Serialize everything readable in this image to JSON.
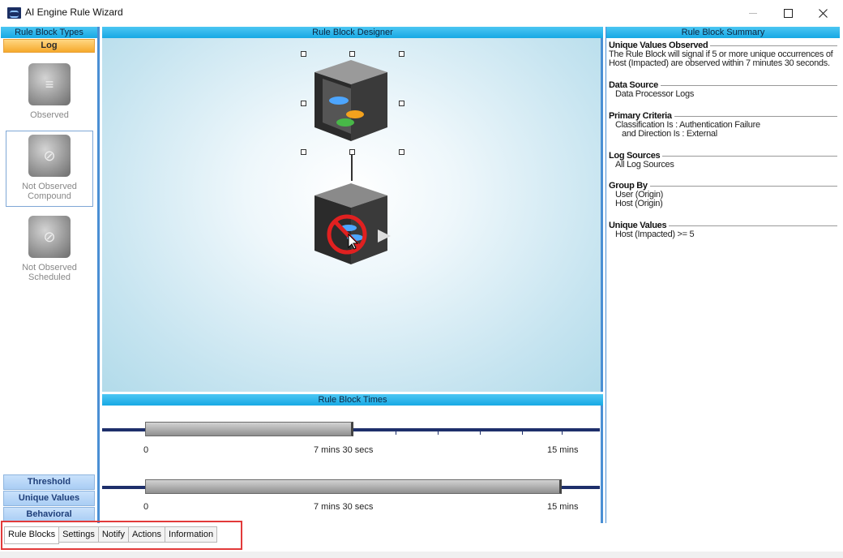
{
  "window": {
    "title": "AI Engine Rule Wizard"
  },
  "left_panel": {
    "header": "Rule Block Types",
    "active_category": "Log",
    "items": [
      {
        "label": "Observed",
        "icon": "observed-cube-icon"
      },
      {
        "label": "Not Observed Compound",
        "icon": "not-observed-cube-icon"
      },
      {
        "label": "Not Observed Scheduled",
        "icon": "not-observed-scheduled-cube-icon"
      }
    ],
    "categories": [
      "Threshold",
      "Unique Values",
      "Behavioral"
    ]
  },
  "designer": {
    "header": "Rule Block Designer"
  },
  "times": {
    "header": "Rule Block Times",
    "rows": [
      {
        "start": "0",
        "mid": "7 mins 30 secs",
        "end": "15 mins",
        "fill": 0.5
      },
      {
        "start": "0",
        "mid": "7 mins 30 secs",
        "end": "15 mins",
        "fill": 1.0
      }
    ]
  },
  "summary": {
    "header": "Rule Block Summary",
    "sections": [
      {
        "title": "Unique Values Observed",
        "lines": [
          "The Rule Block will signal if 5 or more unique occurrences of",
          "Host (Impacted) are observed within 7 minutes 30 seconds."
        ]
      },
      {
        "title": "Data Source",
        "lines": [
          "Data Processor Logs"
        ]
      },
      {
        "title": "Primary Criteria",
        "lines": [
          "Classification Is :  Authentication Failure",
          "and Direction Is :  External"
        ]
      },
      {
        "title": "Log Sources",
        "lines": [
          "All Log Sources"
        ]
      },
      {
        "title": "Group By",
        "lines": [
          "User (Origin)",
          "Host (Origin)"
        ]
      },
      {
        "title": "Unique Values",
        "lines": [
          "Host (Impacted) >= 5"
        ]
      }
    ]
  },
  "tabs": [
    "Rule Blocks",
    "Settings",
    "Notify",
    "Actions",
    "Information"
  ],
  "colors": {
    "header_blue": "#17a9e4",
    "log_orange": "#f6a92b",
    "track_navy": "#1e2f6b",
    "highlight_red": "#e23a3a"
  }
}
